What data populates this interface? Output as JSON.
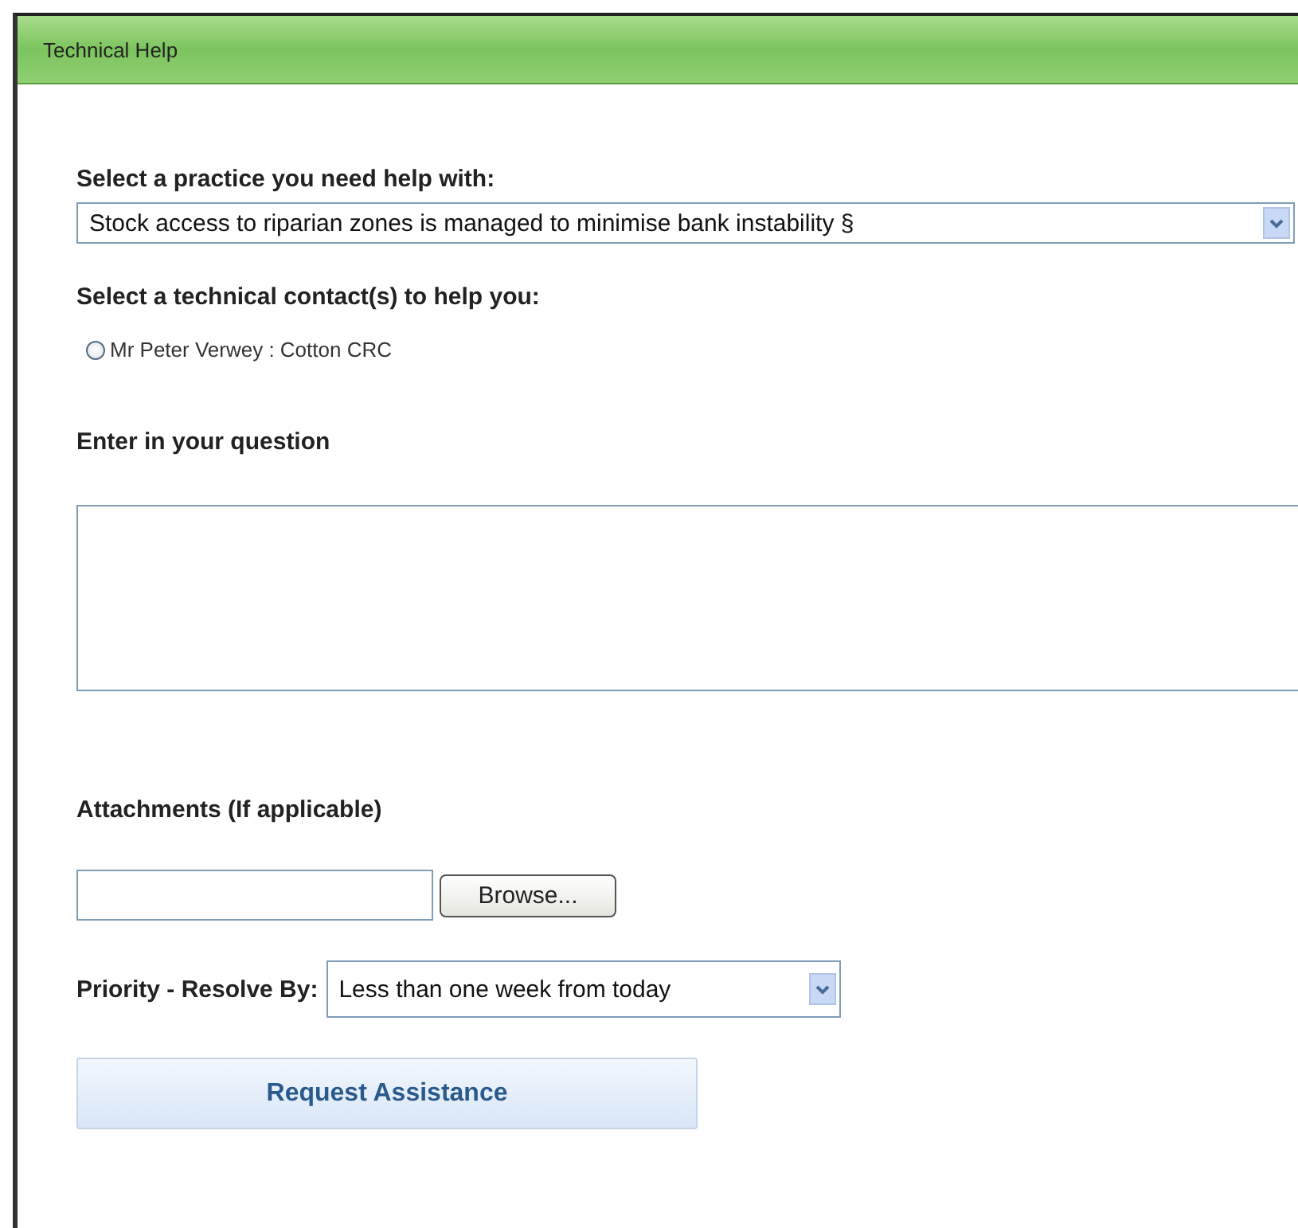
{
  "panel": {
    "title": "Technical Help"
  },
  "practice": {
    "label": "Select a practice you need help with:",
    "value": "Stock access to riparian zones is managed to minimise bank instability §"
  },
  "contacts": {
    "label": "Select a technical contact(s) to help you:",
    "options": [
      {
        "label": "Mr Peter Verwey : Cotton CRC",
        "selected": false
      }
    ]
  },
  "question": {
    "label": "Enter in your question"
  },
  "attachments": {
    "label": "Attachments (If applicable)",
    "browse": "Browse..."
  },
  "priority": {
    "label": "Priority - Resolve By:",
    "value": "Less than one week from today"
  },
  "submit": "Request Assistance"
}
